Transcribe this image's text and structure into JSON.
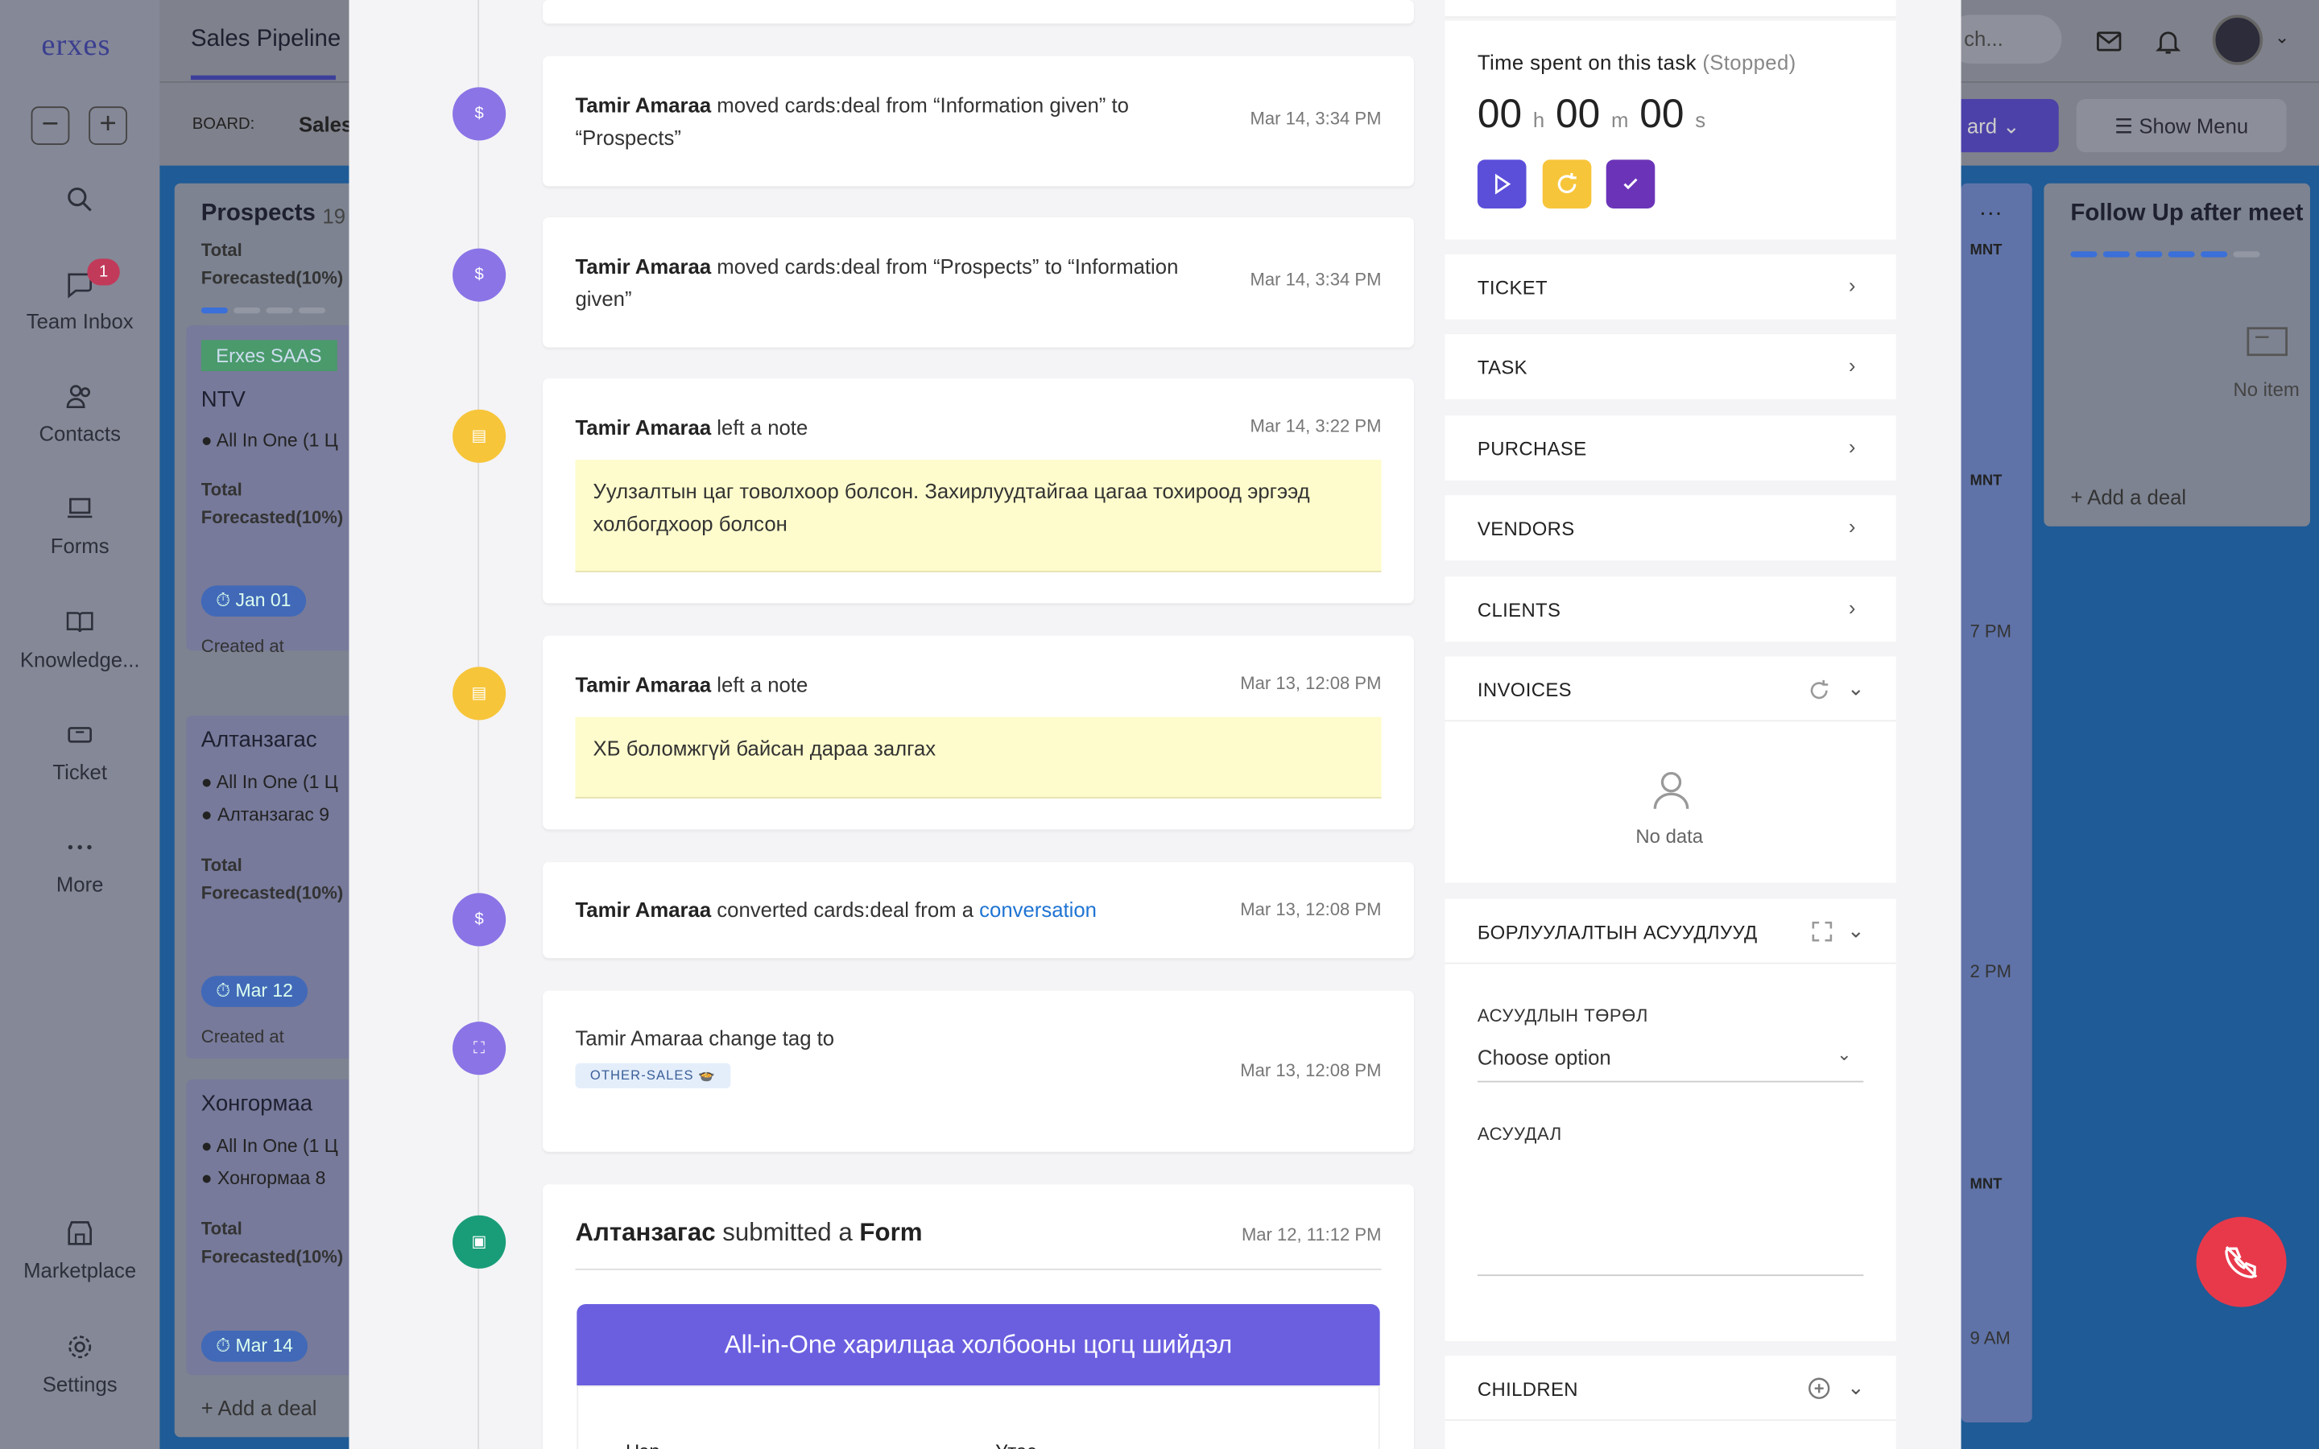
{
  "rail": {
    "logo": "erxes",
    "items": [
      {
        "label": "Team Inbox",
        "icon": "chat-icon",
        "badge": "1"
      },
      {
        "label": "Contacts",
        "icon": "contacts-icon"
      },
      {
        "label": "Forms",
        "icon": "laptop-icon"
      },
      {
        "label": "Knowledge...",
        "icon": "book-icon"
      },
      {
        "label": "Ticket",
        "icon": "ticket-icon"
      },
      {
        "label": "More",
        "icon": "more-icon"
      },
      {
        "label": "Marketplace",
        "icon": "store-icon"
      },
      {
        "label": "Settings",
        "icon": "gear-icon"
      }
    ]
  },
  "topbar": {
    "title": "Sales Pipeline",
    "search_placeholder": "ch...",
    "board_label": "BOARD:",
    "board_value": "Sales",
    "board_button": "ard",
    "show_menu": "Show Menu"
  },
  "board": {
    "prospects": {
      "title": "Prospects",
      "count": "19",
      "forecast": "Total Forecasted(10%)",
      "cards": [
        {
          "tag": "Erxes SAAS",
          "name": "NTV",
          "product": "All In One  (1 Ц",
          "forecast": "Total Forecasted(10%)",
          "date": "Jan 01",
          "created": "Created at"
        },
        {
          "name": "Алтанзагас",
          "product": "All In One  (1 Ц",
          "company": "Алтанзагас 9",
          "forecast": "Total Forecasted(10%)",
          "date": "Mar 12",
          "created": "Created at"
        },
        {
          "name": "Хонгормаа",
          "product": "All In One  (1 Ц",
          "company": "Хонгормаа 8",
          "forecast": "Total Forecasted(10%)",
          "date": "Mar 14"
        }
      ],
      "add_deal": "Add a deal"
    },
    "middle": {
      "labels": [
        "MNT",
        "MNT",
        "MNT"
      ],
      "times": [
        "7 PM",
        "2 PM",
        "9 AM"
      ]
    },
    "follow_up": {
      "title": "Follow Up after meet",
      "empty": "No item",
      "add_deal": "Add a deal"
    }
  },
  "timeline": [
    {
      "icon": "dollar-icon",
      "type": "purple",
      "actor": "Tamir Amaraa",
      "action": "moved  cards:deal from “Information given” to “Prospects”",
      "time": "Mar 14, 3:34 PM"
    },
    {
      "icon": "dollar-icon",
      "type": "purple",
      "actor": "Tamir Amaraa",
      "action": "moved  cards:deal from “Prospects” to “Information given”",
      "time": "Mar 14, 3:34 PM"
    },
    {
      "icon": "note-icon",
      "type": "yellow",
      "actor": "Tamir Amaraa",
      "action": "left a note",
      "time": "Mar 14, 3:22 PM",
      "note": "Уулзалтын цаг товолхоор болсон. Захирлуудтайгаа цагаа тохироод эргээд холбогдхоор болсон"
    },
    {
      "icon": "note-icon",
      "type": "yellow",
      "actor": "Tamir Amaraa",
      "action": "left a note",
      "time": "Mar 13, 12:08 PM",
      "note": "ХБ боломжгүй байсан дараа залгах"
    },
    {
      "icon": "dollar-icon",
      "type": "purple",
      "actor": "Tamir Amaraa",
      "action": "converted cards:deal from a",
      "link": "conversation",
      "time": "Mar 13, 12:08 PM"
    },
    {
      "icon": "tag-icon",
      "type": "purple",
      "actor": "Tamir Amaraa",
      "action": "change tag to",
      "tag": "OTHER-SALES 🍲",
      "time": "Mar 13, 12:08 PM"
    },
    {
      "icon": "form-icon",
      "type": "green",
      "actor": "Алтанзагас",
      "action": "submitted a",
      "link": "Form",
      "time": "Mar 12, 11:12 PM",
      "banner": "All-in-One харилцаа холбооны цогц шийдэл",
      "fields": [
        "Нэр",
        "Утас"
      ]
    }
  ],
  "timer": {
    "label": "Time spent on this task",
    "state": "(Stopped)",
    "hours": "00",
    "h": "h",
    "minutes": "00",
    "m": "m",
    "seconds": "00",
    "s": "s"
  },
  "sections": {
    "ticket": "TICKET",
    "task": "TASK",
    "purchase": "PURCHASE",
    "vendors": "VENDORS",
    "clients": "CLIENTS",
    "invoices": "INVOICES",
    "no_data": "No data",
    "questions": "БОРЛУУЛАЛТЫН АСУУДЛУУД",
    "question_type_label": "АСУУДЛЫН ТӨРӨЛ",
    "question_type_value": "Choose option",
    "question_label": "АСУУДАЛ",
    "children": "CHILDREN"
  },
  "colors": {
    "accent": "#5b4ed9",
    "purple_dot": "#8b74e6",
    "yellow_dot": "#f7c53a",
    "green_dot": "#199d78",
    "note_bg": "#fefccc",
    "fab": "#e8394b"
  }
}
